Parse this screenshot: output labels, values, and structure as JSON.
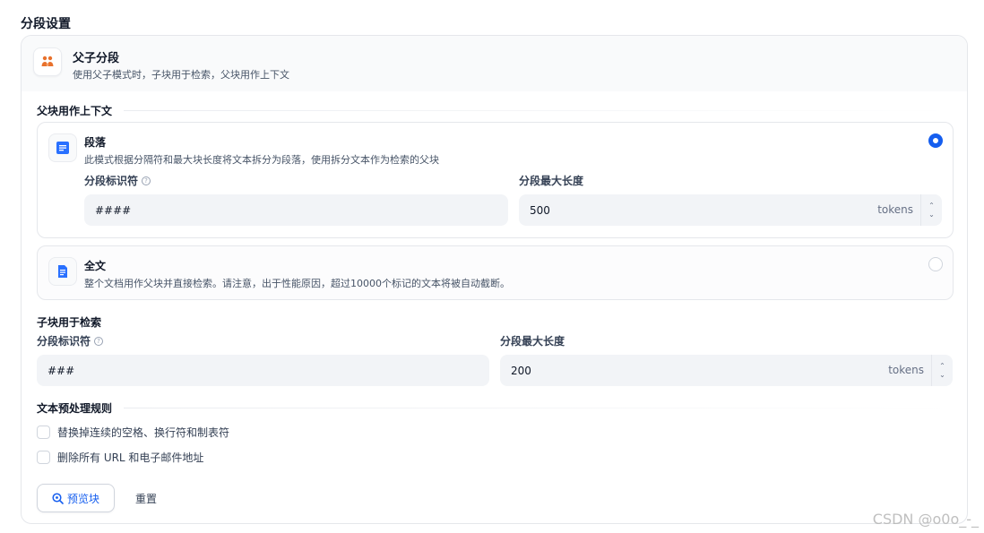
{
  "page_title": "分段设置",
  "mode": {
    "icon": "parent-child-icon",
    "title": "父子分段",
    "description": "使用父子模式时，子块用于检索，父块用作上下文"
  },
  "parent_section": {
    "label": "父块用作上下文",
    "options": [
      {
        "icon": "paragraph-icon",
        "title": "段落",
        "description": "此模式根据分隔符和最大块长度将文本拆分为段落，使用拆分文本作为检索的父块",
        "selected": true,
        "separator_label": "分段标识符",
        "separator_value": "####",
        "max_length_label": "分段最大长度",
        "max_length_value": "500",
        "unit": "tokens"
      },
      {
        "icon": "document-icon",
        "title": "全文",
        "description": "整个文档用作父块并直接检索。请注意，出于性能原因，超过10000个标记的文本将被自动截断。",
        "selected": false
      }
    ]
  },
  "child_section": {
    "label": "子块用于检索",
    "separator_label": "分段标识符",
    "separator_value": "###",
    "max_length_label": "分段最大长度",
    "max_length_value": "200",
    "unit": "tokens"
  },
  "preprocess": {
    "label": "文本预处理规则",
    "rules": [
      {
        "label": "替换掉连续的空格、换行符和制表符",
        "checked": false
      },
      {
        "label": "删除所有 URL 和电子邮件地址",
        "checked": false
      }
    ]
  },
  "actions": {
    "preview_label": "预览块",
    "reset_label": "重置"
  },
  "watermark": "CSDN @o0o_-_",
  "colors": {
    "accent": "#155eef",
    "icon_orange": "#e8712c"
  }
}
